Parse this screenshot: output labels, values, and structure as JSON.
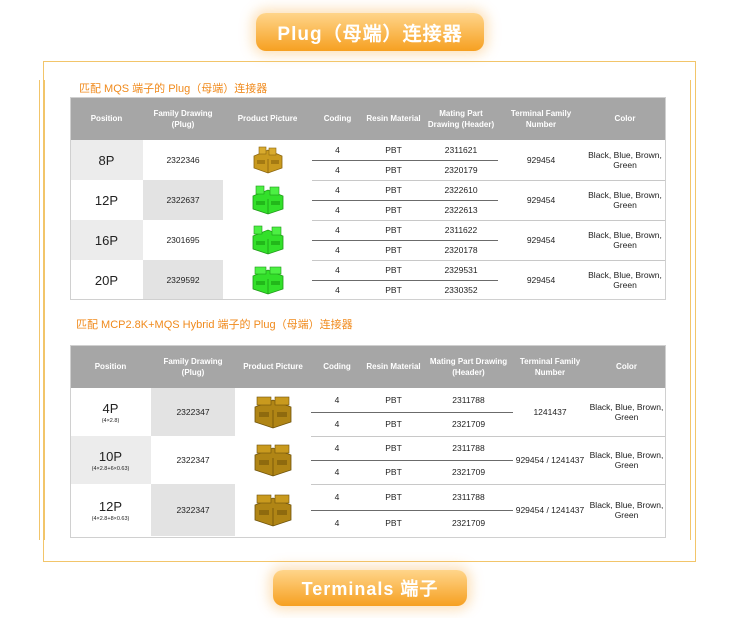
{
  "header": {
    "title": "Plug（母端）连接器"
  },
  "footer": {
    "title": "Terminals 端子"
  },
  "colors": {
    "accent": "#f6a021",
    "section_title": "#f08a1c",
    "header_bg": "#a6a6a6",
    "plug_yellow": "#c99a1e",
    "plug_green": "#33e02a",
    "hybrid_gold": "#b08515"
  },
  "table1": {
    "section_title": "匹配 MQS 端子的 Plug（母端）连接器",
    "headers": {
      "position": "Position",
      "family": "Family Drawing (Plug)",
      "picture": "Product Picture",
      "coding": "Coding",
      "resin": "Resin Material",
      "mating": "Mating Part Drawing (Header)",
      "terminal": "Terminal Family Number",
      "color": "Color"
    },
    "rows": [
      {
        "position": "8P",
        "family": "2322346",
        "picture_icon": "yellow-plug-connector-icon",
        "subs": [
          {
            "coding": "4",
            "resin": "PBT",
            "mating": "2311621"
          },
          {
            "coding": "4",
            "resin": "PBT",
            "mating": "2320179"
          }
        ],
        "terminal": "929454",
        "color": "Black, Blue, Brown, Green"
      },
      {
        "position": "12P",
        "family": "2322637",
        "picture_icon": "green-plug-connector-icon",
        "subs": [
          {
            "coding": "4",
            "resin": "PBT",
            "mating": "2322610"
          },
          {
            "coding": "4",
            "resin": "PBT",
            "mating": "2322613"
          }
        ],
        "terminal": "929454",
        "color": "Black, Blue, Brown, Green"
      },
      {
        "position": "16P",
        "family": "2301695",
        "picture_icon": "green-plug-connector-icon",
        "subs": [
          {
            "coding": "4",
            "resin": "PBT",
            "mating": "2311622"
          },
          {
            "coding": "4",
            "resin": "PBT",
            "mating": "2320178"
          }
        ],
        "terminal": "929454",
        "color": "Black, Blue, Brown, Green"
      },
      {
        "position": "20P",
        "family": "2329592",
        "picture_icon": "green-plug-connector-icon",
        "subs": [
          {
            "coding": "4",
            "resin": "PBT",
            "mating": "2329531"
          },
          {
            "coding": "4",
            "resin": "PBT",
            "mating": "2330352"
          }
        ],
        "terminal": "929454",
        "color": "Black, Blue, Brown, Green"
      }
    ]
  },
  "table2": {
    "section_title": "匹配 MCP2.8K+MQS Hybrid 端子的 Plug（母端）连接器",
    "headers": {
      "position": "Position",
      "family": "Family Drawing (Plug)",
      "picture": "Product Picture",
      "coding": "Coding",
      "resin": "Resin Material",
      "mating": "Mating Part Drawing (Header)",
      "terminal": "Terminal Family Number",
      "color": "Color"
    },
    "rows": [
      {
        "position": "4P",
        "position_sub": "(4×2.8)",
        "family": "2322347",
        "picture_icon": "hybrid-plug-connector-icon",
        "subs": [
          {
            "coding": "4",
            "resin": "PBT",
            "mating": "2311788"
          },
          {
            "coding": "4",
            "resin": "PBT",
            "mating": "2321709"
          }
        ],
        "terminal": "1241437",
        "color": "Black, Blue, Brown, Green"
      },
      {
        "position": "10P",
        "position_sub": "(4×2.8+6×0.63)",
        "family": "2322347",
        "picture_icon": "hybrid-plug-connector-icon",
        "subs": [
          {
            "coding": "4",
            "resin": "PBT",
            "mating": "2311788"
          },
          {
            "coding": "4",
            "resin": "PBT",
            "mating": "2321709"
          }
        ],
        "terminal": "929454 / 1241437",
        "color": "Black, Blue, Brown, Green"
      },
      {
        "position": "12P",
        "position_sub": "(4×2.8+8×0.63)",
        "family": "2322347",
        "picture_icon": "hybrid-plug-connector-icon",
        "subs": [
          {
            "coding": "4",
            "resin": "PBT",
            "mating": "2311788"
          },
          {
            "coding": "4",
            "resin": "PBT",
            "mating": "2321709"
          }
        ],
        "terminal": "929454 / 1241437",
        "color": "Black, Blue, Brown, Green"
      }
    ]
  }
}
